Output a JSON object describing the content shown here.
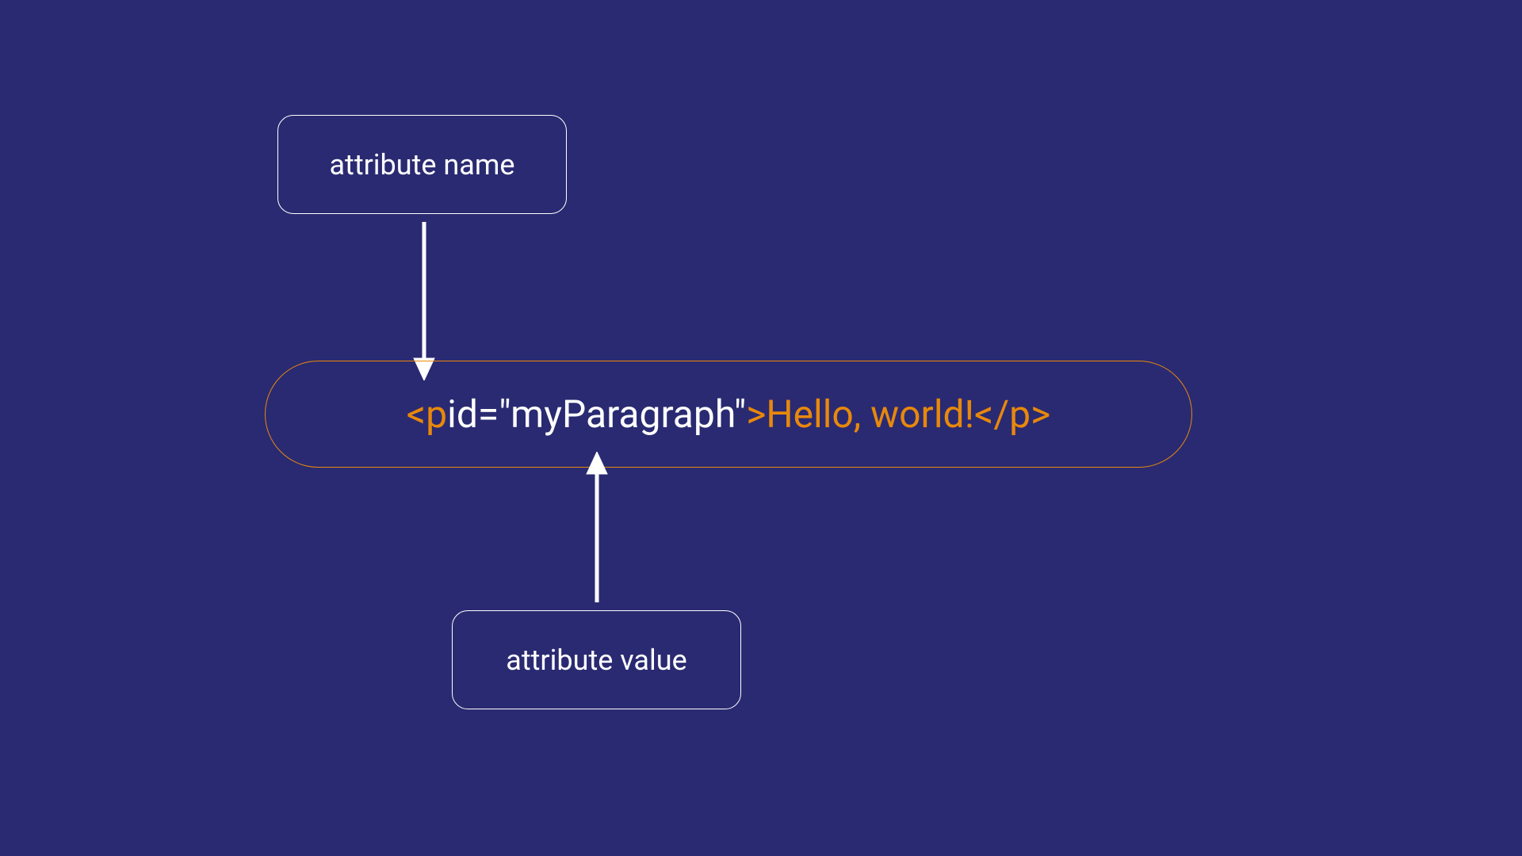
{
  "labels": {
    "top": "attribute name",
    "bottom": "attribute value"
  },
  "code": {
    "part1": "<p ",
    "part2": "id=\"myParagraph\"",
    "part3": ">",
    "part4": "Hello, world!",
    "part5": "</p>"
  },
  "colors": {
    "background": "#2a2a72",
    "accent": "#e8880b",
    "text": "#ffffff"
  }
}
